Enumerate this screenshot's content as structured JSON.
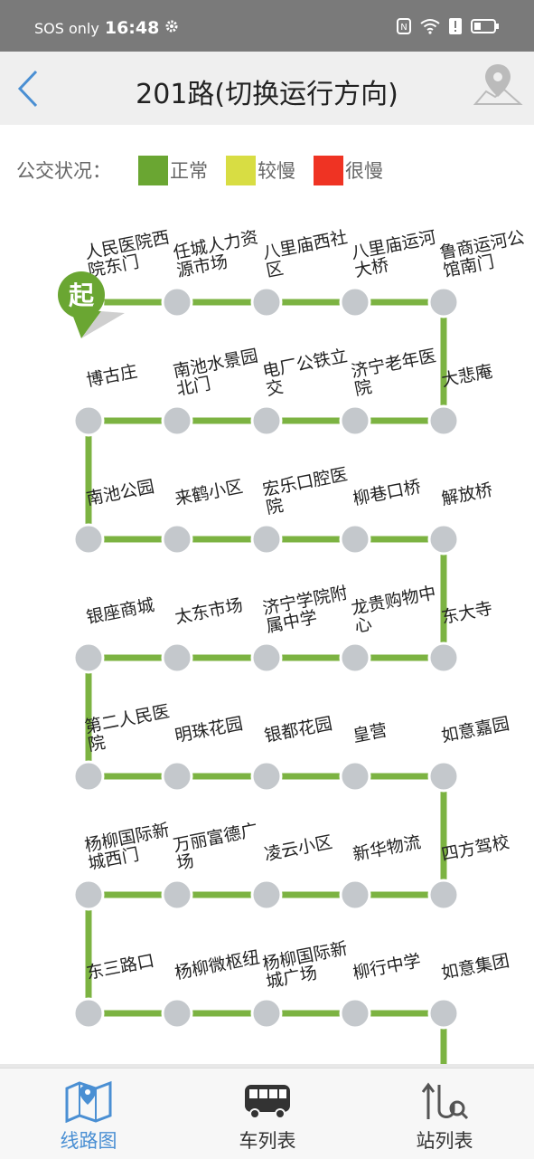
{
  "status_bar": {
    "carrier": "SOS only",
    "time": "16:48"
  },
  "header": {
    "title": "201路(切换运行方向)",
    "back_icon": "chevron-left-icon",
    "map_icon": "map-pin-icon"
  },
  "legend": {
    "label": "公交状况：",
    "items": [
      {
        "label": "正常",
        "color": "#6aa632"
      },
      {
        "label": "较慢",
        "color": "#d8dd43"
      },
      {
        "label": "很慢",
        "color": "#ef3323"
      }
    ]
  },
  "route": {
    "start_badge": "起",
    "line_color": "#7cb342",
    "stop_color": "#c4c8cc",
    "stops": [
      "人民医院西院东门",
      "任城人力资源市场",
      "八里庙西社区",
      "八里庙运河大桥",
      "鲁商运河公馆南门",
      "大悲庵",
      "济宁老年医院",
      "电厂公铁立交",
      "南池水景园北门",
      "博古庄",
      "南池公园",
      "来鹤小区",
      "宏乐口腔医院",
      "柳巷口桥",
      "解放桥",
      "东大寺",
      "龙贵购物中心",
      "济宁学院附属中学",
      "太东市场",
      "银座商城",
      "第二人民医院",
      "明珠花园",
      "银都花园",
      "皇营",
      "如意嘉园",
      "四方驾校",
      "新华物流",
      "凌云小区",
      "万丽富德广场",
      "杨柳国际新城西门",
      "东三路口",
      "杨柳微枢纽",
      "杨柳国际新城广场",
      "柳行中学",
      "如意集团"
    ]
  },
  "tabs": [
    {
      "label": "线路图",
      "icon": "route-map-icon",
      "active": true
    },
    {
      "label": "车列表",
      "icon": "bus-icon",
      "active": false
    },
    {
      "label": "站列表",
      "icon": "station-search-icon",
      "active": false
    }
  ]
}
